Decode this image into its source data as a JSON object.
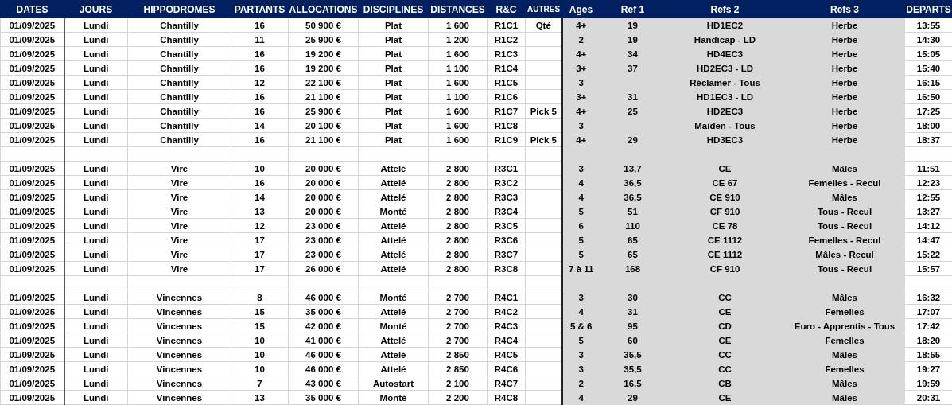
{
  "table": {
    "columns": [
      "DATES",
      "JOURS",
      "HIPPODROMES",
      "PARTANTS",
      "ALLOCATIONS",
      "DISCIPLINES",
      "DISTANCES",
      "R&C",
      "AUTRES",
      "Ages",
      "Ref 1",
      "Refs 2",
      "Refs 3",
      "DEPARTS"
    ],
    "sections": [
      {
        "rows": [
          [
            "01/09/2025",
            "Lundi",
            "Chantilly",
            "16",
            "50 900 €",
            "Plat",
            "1 600",
            "R1C1",
            "Qté",
            "4+",
            "19",
            "HD1EC2",
            "Herbe",
            "13:55"
          ],
          [
            "01/09/2025",
            "Lundi",
            "Chantilly",
            "11",
            "25 900 €",
            "Plat",
            "1 200",
            "R1C2",
            null,
            "2",
            "19",
            "Handicap - LD",
            "Herbe",
            "14:30"
          ],
          [
            "01/09/2025",
            "Lundi",
            "Chantilly",
            "16",
            "19 200 €",
            "Plat",
            "1 600",
            "R1C3",
            null,
            "4+",
            "34",
            "HD4EC3",
            "Herbe",
            "15:05"
          ],
          [
            "01/09/2025",
            "Lundi",
            "Chantilly",
            "16",
            "19 200 €",
            "Plat",
            "1 100",
            "R1C4",
            null,
            "3+",
            "37",
            "HD2EC3 - LD",
            "Herbe",
            "15:40"
          ],
          [
            "01/09/2025",
            "Lundi",
            "Chantilly",
            "12",
            "22 100 €",
            "Plat",
            "1 600",
            "R1C5",
            null,
            "3",
            null,
            "Réclamer - Tous",
            "Herbe",
            "16:15"
          ],
          [
            "01/09/2025",
            "Lundi",
            "Chantilly",
            "16",
            "21 100 €",
            "Plat",
            "1 100",
            "R1C6",
            null,
            "3+",
            "31",
            "HD1EC3 - LD",
            "Herbe",
            "16:50"
          ],
          [
            "01/09/2025",
            "Lundi",
            "Chantilly",
            "16",
            "25 900 €",
            "Plat",
            "1 600",
            "R1C7",
            "Pick 5",
            "4+",
            "25",
            "HD2EC3",
            "Herbe",
            "17:25"
          ],
          [
            "01/09/2025",
            "Lundi",
            "Chantilly",
            "14",
            "20 100 €",
            "Plat",
            "1 600",
            "R1C8",
            null,
            "3",
            null,
            "Maiden - Tous",
            "Herbe",
            "18:00"
          ],
          [
            "01/09/2025",
            "Lundi",
            "Chantilly",
            "16",
            "21 100 €",
            "Plat",
            "1 600",
            "R1C9",
            "Pick 5",
            "4+",
            "29",
            "HD3EC3",
            "Herbe",
            "18:37"
          ]
        ]
      },
      {
        "rows": [
          [
            "01/09/2025",
            "Lundi",
            "Vire",
            "10",
            "20 000 €",
            "Attelé",
            "2 800",
            "R3C1",
            null,
            "3",
            "13,7",
            "CE",
            "Mâles",
            "11:51"
          ],
          [
            "01/09/2025",
            "Lundi",
            "Vire",
            "16",
            "20 000 €",
            "Attelé",
            "2 800",
            "R3C2",
            null,
            "4",
            "36,5",
            "CE 67",
            "Femelles - Recul",
            "12:23"
          ],
          [
            "01/09/2025",
            "Lundi",
            "Vire",
            "14",
            "20 000 €",
            "Attelé",
            "2 800",
            "R3C3",
            null,
            "4",
            "36,5",
            "CE 910",
            "Mâles",
            "12:55"
          ],
          [
            "01/09/2025",
            "Lundi",
            "Vire",
            "13",
            "20 000 €",
            "Monté",
            "2 800",
            "R3C4",
            null,
            "5",
            "51",
            "CF 910",
            "Tous - Recul",
            "13:27"
          ],
          [
            "01/09/2025",
            "Lundi",
            "Vire",
            "12",
            "23 000 €",
            "Attelé",
            "2 800",
            "R3C5",
            null,
            "6",
            "110",
            "CE 78",
            "Tous - Recul",
            "14:12"
          ],
          [
            "01/09/2025",
            "Lundi",
            "Vire",
            "17",
            "23 000 €",
            "Attelé",
            "2 800",
            "R3C6",
            null,
            "5",
            "65",
            "CE 1112",
            "Femelles - Recul",
            "14:47"
          ],
          [
            "01/09/2025",
            "Lundi",
            "Vire",
            "17",
            "23 000 €",
            "Attelé",
            "2 800",
            "R3C7",
            null,
            "5",
            "65",
            "CE 1112",
            "Mâles - Recul",
            "15:22"
          ],
          [
            "01/09/2025",
            "Lundi",
            "Vire",
            "17",
            "26 000 €",
            "Attelé",
            "2 800",
            "R3C8",
            null,
            "7 à 11",
            "168",
            "CF 910",
            "Tous - Recul",
            "15:57"
          ]
        ]
      },
      {
        "rows": [
          [
            "01/09/2025",
            "Lundi",
            "Vincennes",
            "8",
            "46 000 €",
            "Monté",
            "2 700",
            "R4C1",
            null,
            "3",
            "30",
            "CC",
            "Mâles",
            "16:32"
          ],
          [
            "01/09/2025",
            "Lundi",
            "Vincennes",
            "15",
            "35 000 €",
            "Attelé",
            "2 700",
            "R4C2",
            null,
            "4",
            "31",
            "CE",
            "Femelles",
            "17:07"
          ],
          [
            "01/09/2025",
            "Lundi",
            "Vincennes",
            "15",
            "42 000 €",
            "Monté",
            "2 700",
            "R4C3",
            null,
            "5 & 6",
            "95",
            "CD",
            "Euro - Apprentis - Tous",
            "17:42"
          ],
          [
            "01/09/2025",
            "Lundi",
            "Vincennes",
            "10",
            "41 000 €",
            "Attelé",
            "2 700",
            "R4C4",
            null,
            "5",
            "60",
            "CE",
            "Femelles",
            "18:20"
          ],
          [
            "01/09/2025",
            "Lundi",
            "Vincennes",
            "10",
            "46 000 €",
            "Attelé",
            "2 850",
            "R4C5",
            null,
            "3",
            "35,5",
            "CC",
            "Mâles",
            "18:55"
          ],
          [
            "01/09/2025",
            "Lundi",
            "Vincennes",
            "10",
            "46 000 €",
            "Attelé",
            "2 850",
            "R4C6",
            null,
            "3",
            "35,5",
            "CC",
            "Femelles",
            "19:27"
          ],
          [
            "01/09/2025",
            "Lundi",
            "Vincennes",
            "7",
            "43 000 €",
            "Autostart",
            "2 100",
            "R4C7",
            null,
            "2",
            "16,5",
            "CB",
            "Mâles",
            "19:59"
          ],
          [
            "01/09/2025",
            "Lundi",
            "Vincennes",
            "13",
            "35 000 €",
            "Monté",
            "2 200",
            "R4C8",
            null,
            "4",
            "29",
            "CE",
            "Mâles",
            "20:31"
          ]
        ]
      }
    ]
  }
}
